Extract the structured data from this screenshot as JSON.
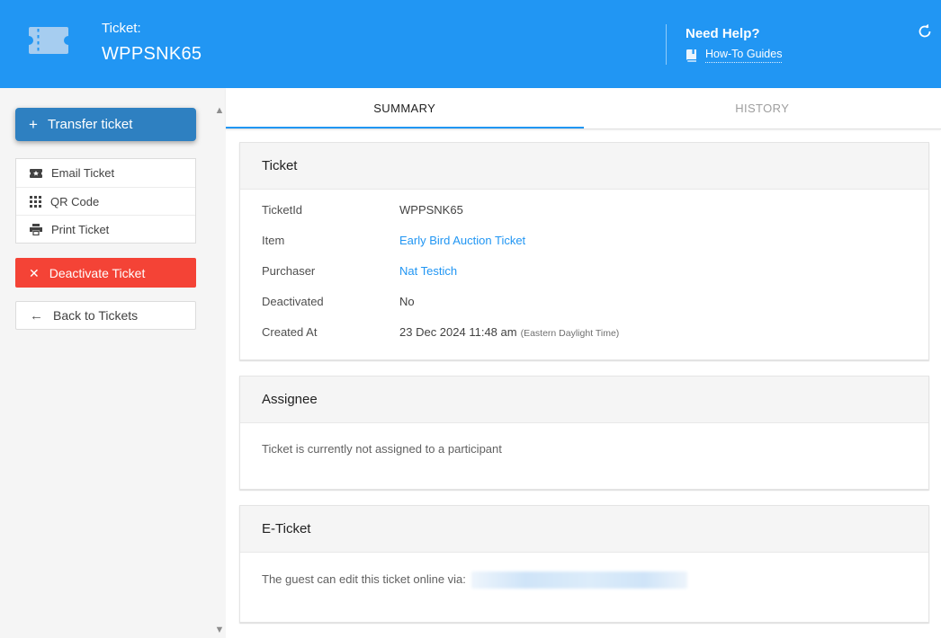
{
  "header": {
    "title_label": "Ticket:",
    "ticket_id": "WPPSNK65",
    "need_help": "Need Help?",
    "how_to_guides": "How-To Guides"
  },
  "sidebar": {
    "transfer_label": "Transfer ticket",
    "actions": [
      {
        "icon": "ticket-email-icon",
        "label": "Email Ticket"
      },
      {
        "icon": "qr-code-icon",
        "label": "QR Code"
      },
      {
        "icon": "printer-icon",
        "label": "Print Ticket"
      }
    ],
    "deactivate_label": "Deactivate Ticket",
    "back_label": "Back to Tickets"
  },
  "tabs": [
    {
      "label": "SUMMARY",
      "active": true
    },
    {
      "label": "HISTORY",
      "active": false
    }
  ],
  "ticket_card": {
    "title": "Ticket",
    "fields": [
      {
        "label": "TicketId",
        "value": "WPPSNK65"
      },
      {
        "label": "Item",
        "value": "Early Bird Auction Ticket"
      },
      {
        "label": "Purchaser",
        "value": "Nat Testich"
      },
      {
        "label": "Deactivated",
        "value": "No"
      },
      {
        "label": "Created At",
        "value": "23 Dec 2024 11:48 am",
        "suffix": "(Eastern Daylight Time)"
      }
    ]
  },
  "assignee_card": {
    "title": "Assignee",
    "message": "Ticket is currently not assigned to a participant"
  },
  "eticket_card": {
    "title": "E-Ticket",
    "message": "The guest can edit this ticket online via:"
  },
  "colors": {
    "header_bg": "#2196f3",
    "transfer_button": "#2e80c1",
    "deactivate_button": "#f44336",
    "link": "#2196f3",
    "active_tab_underline": "#2196f3"
  }
}
